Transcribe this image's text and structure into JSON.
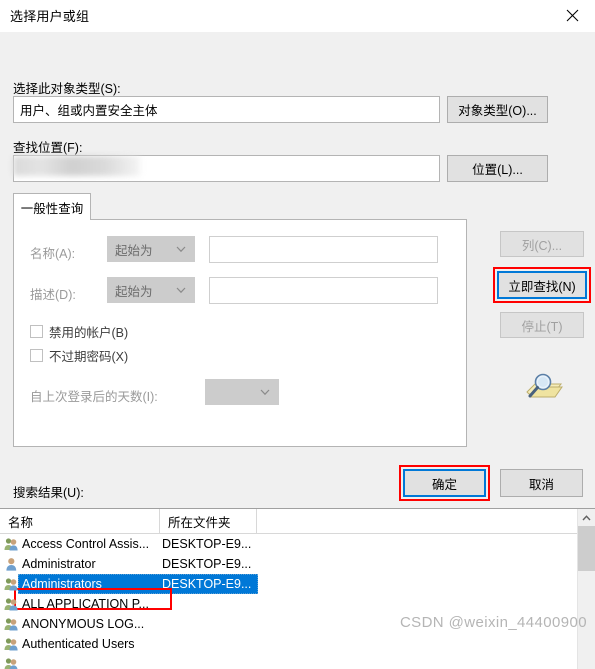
{
  "window": {
    "title": "选择用户或组",
    "close_icon": "close-icon"
  },
  "object_type": {
    "label": "选择此对象类型(S):",
    "value": "用户、组或内置安全主体",
    "button": "对象类型(O)..."
  },
  "location": {
    "label": "查找位置(F):",
    "value": "",
    "button": "位置(L)..."
  },
  "tab": {
    "label": "一般性查询"
  },
  "query": {
    "name_label": "名称(A):",
    "name_operator": "起始为",
    "name_value": "",
    "desc_label": "描述(D):",
    "desc_operator": "起始为",
    "desc_value": "",
    "disabled_accounts": "禁用的帐户(B)",
    "non_expiring_password": "不过期密码(X)",
    "days_label": "自上次登录后的天数(I):",
    "days_value": ""
  },
  "side_buttons": {
    "columns": "列(C)...",
    "find_now": "立即查找(N)",
    "stop": "停止(T)",
    "search_icon": "search-folder-icon"
  },
  "dialog_buttons": {
    "ok": "确定",
    "cancel": "取消"
  },
  "results": {
    "label": "搜索结果(U):",
    "columns": [
      "名称",
      "所在文件夹"
    ],
    "rows": [
      {
        "name": "Access Control Assis...",
        "folder": "DESKTOP-E9...",
        "icon": "group-icon",
        "selected": false
      },
      {
        "name": "Administrator",
        "folder": "DESKTOP-E9...",
        "icon": "user-icon",
        "selected": false
      },
      {
        "name": "Administrators",
        "folder": "DESKTOP-E9...",
        "icon": "group-icon",
        "selected": true
      },
      {
        "name": "ALL APPLICATION P...",
        "folder": "",
        "icon": "group-icon",
        "selected": false
      },
      {
        "name": "ANONYMOUS LOG...",
        "folder": "",
        "icon": "group-icon",
        "selected": false
      },
      {
        "name": "Authenticated Users",
        "folder": "",
        "icon": "group-icon",
        "selected": false
      }
    ]
  },
  "scrollbar": {
    "up_icon": "chevron-up-icon"
  },
  "watermark": {
    "text": "CSDN @weixin_44400900"
  },
  "colors": {
    "accent": "#0078d7",
    "annotation": "#ff0000",
    "dialog_bg": "#f0f0f0"
  }
}
